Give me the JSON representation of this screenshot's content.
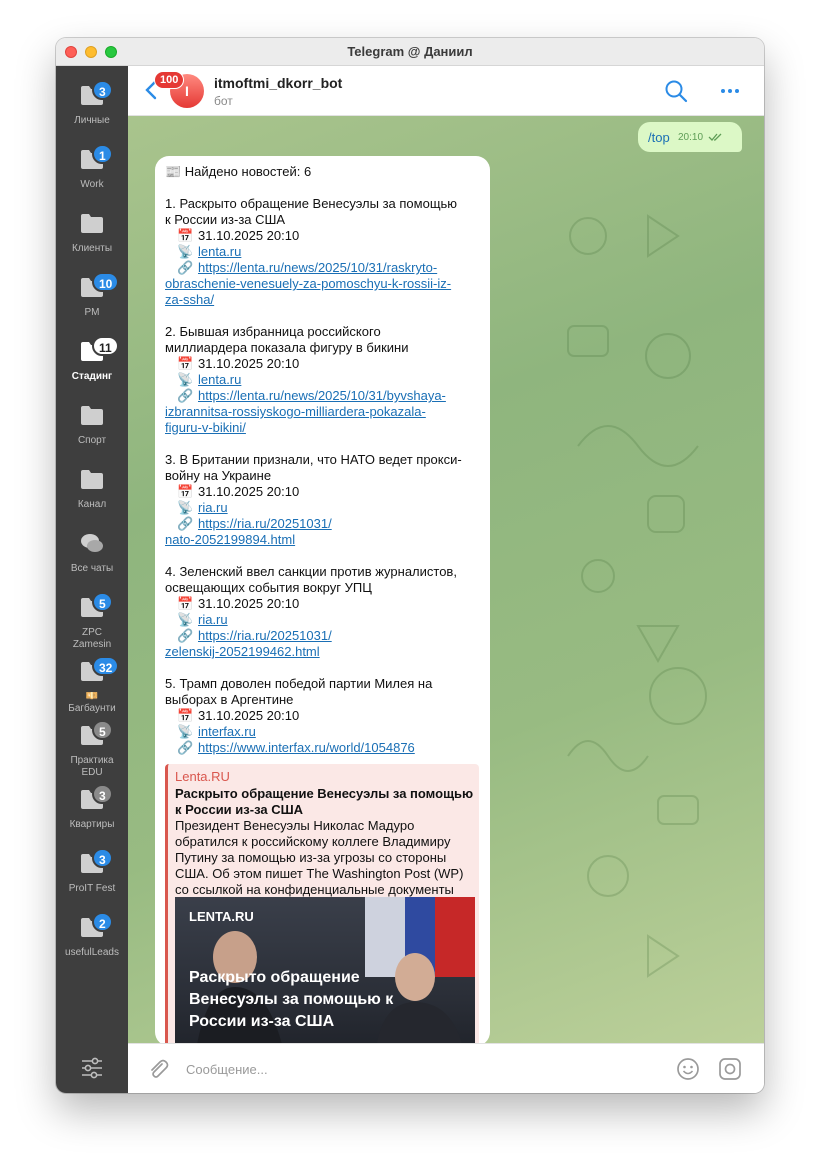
{
  "window": {
    "title": "Telegram @ Даниил"
  },
  "sidebar": {
    "folders": [
      {
        "label": "Личные",
        "badge": "3"
      },
      {
        "label": "Work",
        "badge": "1"
      },
      {
        "label": "Клиенты",
        "badge": ""
      },
      {
        "label": "PM",
        "badge": "10"
      },
      {
        "label": "Стадинг",
        "badge": "11"
      },
      {
        "label": "Спорт",
        "badge": ""
      },
      {
        "label": "Канал",
        "badge": ""
      },
      {
        "label": "Все чаты",
        "badge": ""
      },
      {
        "label": "ZPC",
        "label2": "Zamesin",
        "badge": "5"
      },
      {
        "label": "💴",
        "label2": "Багбаунти",
        "badge": "32"
      },
      {
        "label": "Практика",
        "label2": "EDU",
        "badge": "5"
      },
      {
        "label": "Квартиры",
        "badge": "3"
      },
      {
        "label": "ProIT Fest",
        "badge": "3"
      },
      {
        "label": "usefulLeads",
        "badge": "2"
      }
    ]
  },
  "header": {
    "unread": "100",
    "avatar_letter": "I",
    "title": "itmoftmi_dkorr_bot",
    "subtitle": "бот"
  },
  "outgoing": {
    "text": "/top",
    "time": "20:10"
  },
  "message": {
    "heading": "📰 Найдено новостей: 6",
    "items": [
      {
        "title1": "1. Раскрыто обращение Венесуэлы за помощью",
        "title2": "к России из-за США",
        "date": "31.10.2025 20:10",
        "source": "lenta.ru",
        "url1": "https://lenta.ru/news/2025/10/31/raskryto-",
        "url2": "obraschenie-venesuely-za-pomoschyu-k-rossii-iz-",
        "url3": "za-ssha/"
      },
      {
        "title1": "2. Бывшая избранница российского",
        "title2": "миллиардера показала фигуру в бикини",
        "date": "31.10.2025 20:10",
        "source": "lenta.ru",
        "url1": "https://lenta.ru/news/2025/10/31/byvshaya-",
        "url2": "izbrannitsa-rossiyskogo-milliardera-pokazala-",
        "url3": "figuru-v-bikini/"
      },
      {
        "title1": "3. В Британии признали, что НАТО ведет прокси-",
        "title2": "войну на Украине",
        "date": "31.10.2025 20:10",
        "source": "ria.ru",
        "url1": "https://ria.ru/20251031/",
        "url2": "nato-2052199894.html"
      },
      {
        "title1": "4. Зеленский ввел санкции против журналистов,",
        "title2": "освещающих события вокруг УПЦ",
        "date": "31.10.2025 20:10",
        "source": "ria.ru",
        "url1": "https://ria.ru/20251031/",
        "url2": "zelenskij-2052199462.html"
      },
      {
        "title1": "5. Трамп доволен победой партии Милея на",
        "title2": "выборах в Аргентине",
        "date": "31.10.2025 20:10",
        "source": "interfax.ru",
        "url1": "https://www.interfax.ru/world/1054876"
      }
    ],
    "icons": {
      "date": "calendar-icon",
      "source": "satellite-icon",
      "url": "link-icon"
    }
  },
  "preview": {
    "site": "Lenta.RU",
    "title1": "Раскрыто обращение Венесуэлы за помощью",
    "title2": "к России из-за США",
    "text": [
      "Президент Венесуэлы Николас Мадуро",
      "обратился к российскому коллеге Владимиру",
      "Путину за помощью из-за угрозы со стороны",
      "США. Об этом пишет The Washington Post (WP)",
      "со ссылкой на конфиденциальные документы"
    ],
    "image_brand": "LENTA.RU",
    "image_lines": [
      "Раскрыто обращение",
      "Венесуэлы за помощью к",
      "России из-за США"
    ]
  },
  "composer": {
    "placeholder": "Сообщение..."
  },
  "colors": {
    "accent": "#2b8be6",
    "link": "#1a6fb5",
    "outgoing_bubble": "#dcf8c6",
    "preview_accent": "#d9574e"
  }
}
